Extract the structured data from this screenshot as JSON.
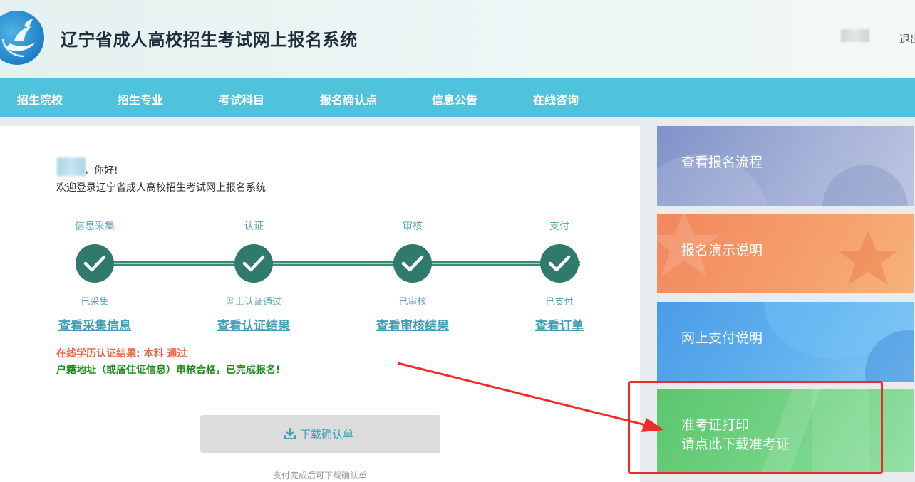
{
  "header": {
    "title": "辽宁省成人高校招生考试网上报名系统",
    "logout_label": "退出"
  },
  "nav": {
    "items": [
      {
        "label": "招生院校"
      },
      {
        "label": "招生专业"
      },
      {
        "label": "考试科目"
      },
      {
        "label": "报名确认点"
      },
      {
        "label": "信息公告"
      },
      {
        "label": "在线咨询"
      }
    ]
  },
  "main": {
    "greeting": "，你好!",
    "welcome": "欢迎登录辽宁省成人高校招生考试网上报名系统",
    "steps": [
      {
        "title": "信息采集",
        "status": "已采集",
        "link": "查看采集信息"
      },
      {
        "title": "认证",
        "status": "网上认证通过",
        "link": "查看认证结果"
      },
      {
        "title": "审核",
        "status": "已审核",
        "link": "查看审核结果"
      },
      {
        "title": "支付",
        "status": "已支付",
        "link": "查看订单"
      }
    ],
    "result_line1": "在线学历认证结果: 本科 通过",
    "result_line2": "户籍地址（或居住证信息）审核合格，已完成报名!",
    "download_label": "下载确认单",
    "download_note": "支付完成后可下载确认单"
  },
  "side_panels": [
    {
      "label": "查看报名流程"
    },
    {
      "label": "报名演示说明"
    },
    {
      "label": "网上支付说明"
    },
    {
      "label_line1": "准考证打印",
      "label_line2": "请点此下载准考证"
    }
  ],
  "colors": {
    "nav_bg": "#4fc3db",
    "step_green": "#2f7a6a",
    "link_blue": "#3f9fb3",
    "result_orange": "#e8674a",
    "result_green": "#1f8a1f",
    "annotation_red": "#ee2a2a"
  },
  "icons": {
    "logo": "dove-logo-icon",
    "step": "checkmark-icon",
    "download": "download-icon"
  }
}
